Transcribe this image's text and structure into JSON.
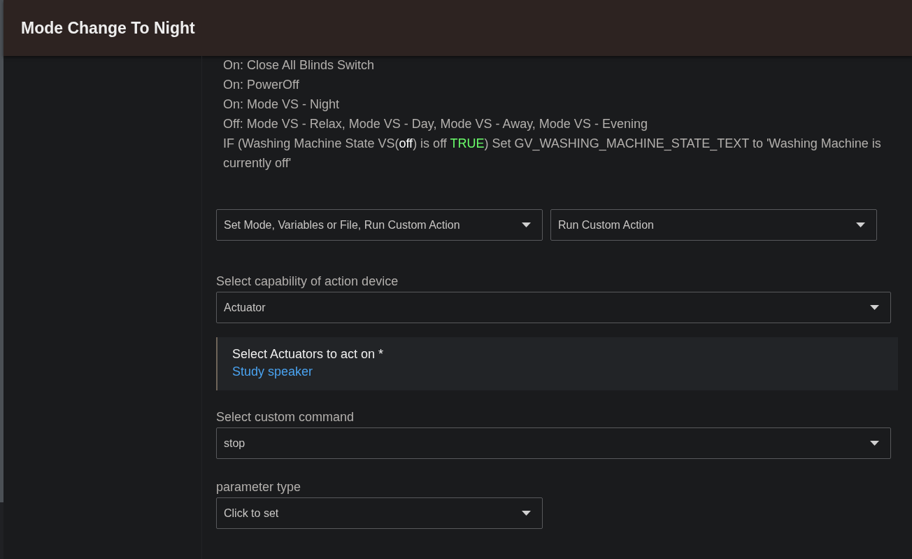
{
  "window": {
    "title": "Mode Change To Night"
  },
  "summary_lines": [
    {
      "segments": [
        {
          "kind": "plain",
          "text": "On: Close All Blinds Switch"
        }
      ]
    },
    {
      "segments": [
        {
          "kind": "plain",
          "text": "On: PowerOff"
        }
      ]
    },
    {
      "segments": [
        {
          "kind": "plain",
          "text": "On: Mode VS - Night"
        }
      ]
    },
    {
      "segments": [
        {
          "kind": "plain",
          "text": "Off: Mode VS - Relax, Mode VS - Day, Mode VS - Away, Mode VS - Evening"
        }
      ]
    },
    {
      "segments": [
        {
          "kind": "plain",
          "text": "IF (Washing Machine State VS("
        },
        {
          "kind": "value",
          "text": "off"
        },
        {
          "kind": "plain",
          "text": ") is off "
        },
        {
          "kind": "true",
          "text": "TRUE"
        },
        {
          "kind": "plain",
          "text": ") Set GV_WASHING_MACHINE_STATE_TEXT to 'Washing Machine is currently off'"
        }
      ]
    }
  ],
  "action_type_selects": [
    {
      "value": "Set Mode, Variables or File, Run Custom Action"
    },
    {
      "value": "Run Custom Action"
    }
  ],
  "capability": {
    "label": "Select capability of action device",
    "value": "Actuator"
  },
  "device_picker": {
    "label": "Select Actuators to act on *",
    "value": "Study speaker"
  },
  "custom_command": {
    "label": "Select custom command",
    "value": "stop"
  },
  "parameter_type": {
    "label": "parameter type",
    "value": "Click to set"
  }
}
